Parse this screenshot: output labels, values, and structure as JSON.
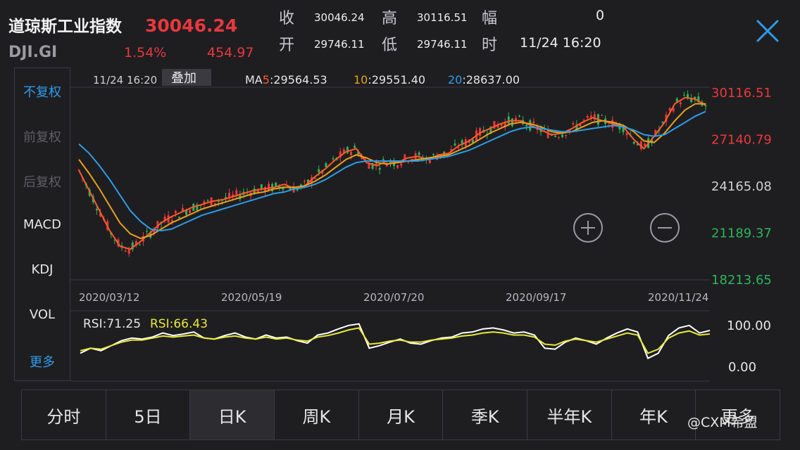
{
  "header": {
    "name": "道琼斯工业指数",
    "price": "30046.24",
    "code": "DJI.GI",
    "change_pct": "1.54%",
    "change_amt": "454.97",
    "quote": {
      "close_label": "收",
      "close_value": "30046.24",
      "high_label": "高",
      "high_value": "30116.51",
      "amp_label": "幅",
      "amp_value": "0",
      "open_label": "开",
      "open_value": "29746.11",
      "low_label": "低",
      "low_value": "29746.11",
      "time_label": "时",
      "time_value": "11/24 16:20"
    }
  },
  "side_menu": [
    {
      "label": "不复权",
      "state": "active"
    },
    {
      "label": "前复权",
      "state": "disabled"
    },
    {
      "label": "后复权",
      "state": "disabled"
    },
    {
      "label": "MACD",
      "state": "normal"
    },
    {
      "label": "KDJ",
      "state": "normal"
    },
    {
      "label": "VOL",
      "state": "normal"
    },
    {
      "label": "更多",
      "state": "active"
    }
  ],
  "chart_data": [
    {
      "type": "line",
      "title": "",
      "cursor_time": "11/24 16:20",
      "overlay_button": "叠加",
      "ma_labels": {
        "ma5_prefix": "MA",
        "ma5_num": "5",
        "ma5_value": ":29564.53",
        "ma10_num": "10",
        "ma10_value": ":29551.40",
        "ma20_num": "20",
        "ma20_value": ":28637.00"
      },
      "y_ticks": [
        {
          "label": "30116.51",
          "color": "#e8383d"
        },
        {
          "label": "27140.79",
          "color": "#e8383d"
        },
        {
          "label": "24165.08",
          "color": "#cfcfcf"
        },
        {
          "label": "21189.37",
          "color": "#2cb45a"
        },
        {
          "label": "18213.65",
          "color": "#2cb45a"
        }
      ],
      "ylim": [
        18213.65,
        30116.51
      ],
      "x_ticks": [
        "2020/03/12",
        "2020/05/19",
        "2020/07/20",
        "2020/09/17",
        "2020/11/24"
      ],
      "series_colors": {
        "ma5": "#ff5a28",
        "ma10": "#e8a020",
        "ma20": "#2d9de6",
        "up": "#e8383d",
        "down": "#2cb45a"
      },
      "series": [
        {
          "name": "MA5",
          "values": [
            25200,
            23900,
            22600,
            21300,
            20300,
            20100,
            20600,
            21200,
            21800,
            22200,
            22500,
            22800,
            23000,
            23200,
            23300,
            23500,
            23700,
            23900,
            24000,
            24100,
            24300,
            24000,
            24200,
            24800,
            25300,
            25900,
            26400,
            26600,
            25700,
            25500,
            25800,
            25700,
            26000,
            26100,
            25900,
            26200,
            26300,
            26800,
            27100,
            27600,
            27900,
            28200,
            28400,
            28400,
            28100,
            27800,
            27500,
            27600,
            27900,
            28300,
            28600,
            28400,
            28200,
            28000,
            27200,
            26600,
            27400,
            28300,
            29500,
            29900,
            29800,
            29400
          ]
        },
        {
          "name": "MA10",
          "values": [
            25900,
            25000,
            24000,
            22900,
            21800,
            21100,
            20800,
            21000,
            21400,
            21800,
            22100,
            22400,
            22700,
            22900,
            23100,
            23300,
            23500,
            23700,
            23800,
            24000,
            24100,
            24100,
            24200,
            24500,
            24900,
            25400,
            25900,
            26200,
            26000,
            25700,
            25600,
            25700,
            25800,
            25900,
            26000,
            26100,
            26200,
            26500,
            26800,
            27200,
            27600,
            27900,
            28200,
            28300,
            28200,
            28000,
            27700,
            27600,
            27700,
            28000,
            28300,
            28400,
            28300,
            28100,
            27700,
            27100,
            27000,
            27600,
            28400,
            29100,
            29500,
            29500
          ]
        },
        {
          "name": "MA20",
          "values": [
            26900,
            26300,
            25500,
            24600,
            23600,
            22600,
            21900,
            21400,
            21300,
            21400,
            21700,
            22000,
            22300,
            22500,
            22700,
            22900,
            23100,
            23300,
            23500,
            23700,
            23800,
            24000,
            24100,
            24300,
            24600,
            25000,
            25400,
            25700,
            25800,
            25800,
            25800,
            25800,
            25800,
            25800,
            25900,
            26000,
            26100,
            26300,
            26500,
            26800,
            27100,
            27400,
            27700,
            27900,
            28000,
            27900,
            27800,
            27700,
            27700,
            27800,
            27900,
            28000,
            28100,
            28000,
            27800,
            27500,
            27400,
            27500,
            27900,
            28300,
            28700,
            29000
          ]
        }
      ]
    },
    {
      "type": "line",
      "title": "",
      "labels": {
        "rsi1": "RSI:71.25",
        "rsi2": "RSI:66.43"
      },
      "y_ticks": [
        "100.00",
        "0.00"
      ],
      "ylim": [
        0,
        100
      ],
      "series_colors": {
        "rsi1": "#ffffff",
        "rsi2": "#e8e83a"
      },
      "series": [
        {
          "name": "RSI",
          "values": [
            30,
            40,
            35,
            45,
            55,
            60,
            58,
            62,
            70,
            65,
            68,
            72,
            60,
            58,
            65,
            70,
            62,
            58,
            66,
            60,
            62,
            55,
            50,
            66,
            70,
            78,
            85,
            88,
            40,
            45,
            52,
            58,
            50,
            48,
            55,
            60,
            62,
            70,
            72,
            78,
            80,
            76,
            70,
            72,
            66,
            40,
            38,
            52,
            60,
            55,
            48,
            60,
            70,
            78,
            72,
            20,
            30,
            65,
            80,
            85,
            70,
            75
          ]
        },
        {
          "name": "RSI",
          "values": [
            35,
            40,
            38,
            45,
            52,
            56,
            56,
            60,
            64,
            62,
            64,
            66,
            60,
            58,
            62,
            64,
            60,
            58,
            62,
            58,
            60,
            56,
            54,
            62,
            65,
            70,
            76,
            80,
            48,
            50,
            54,
            56,
            52,
            52,
            56,
            58,
            60,
            64,
            66,
            70,
            72,
            70,
            66,
            66,
            62,
            48,
            46,
            54,
            58,
            55,
            52,
            58,
            64,
            70,
            66,
            30,
            38,
            60,
            70,
            74,
            66,
            68
          ]
        }
      ]
    }
  ],
  "tabs": [
    {
      "label": "分时",
      "active": false
    },
    {
      "label": "5日",
      "active": false
    },
    {
      "label": "日K",
      "active": true
    },
    {
      "label": "周K",
      "active": false
    },
    {
      "label": "月K",
      "active": false
    },
    {
      "label": "季K",
      "active": false
    },
    {
      "label": "半年K",
      "active": false
    },
    {
      "label": "年K",
      "active": false
    },
    {
      "label": "更多",
      "active": false
    }
  ],
  "watermark": "@CXM希盟"
}
